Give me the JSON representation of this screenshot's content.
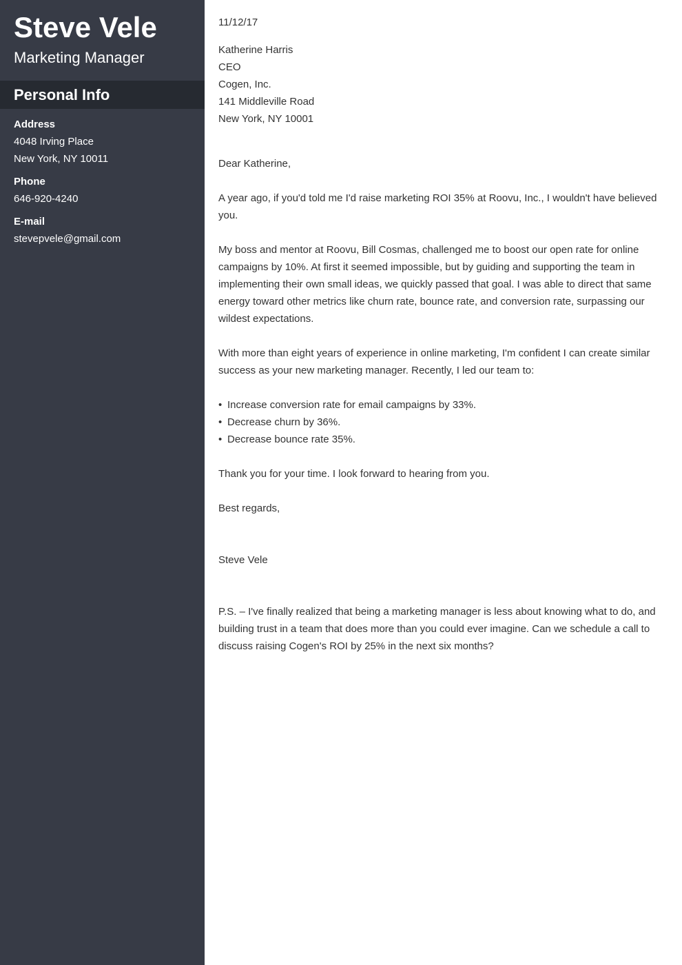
{
  "sidebar": {
    "name": "Steve Vele",
    "job_title": "Marketing Manager",
    "section_title": "Personal Info",
    "address": {
      "label": "Address",
      "lines": [
        "4048 Irving Place",
        "New York, NY 10011"
      ]
    },
    "phone": {
      "label": "Phone",
      "value": "646-920-4240"
    },
    "email": {
      "label": "E-mail",
      "value": "stevepvele@gmail.com"
    }
  },
  "letter": {
    "date": "11/12/17",
    "recipient": {
      "name": "Katherine Harris",
      "title": "CEO",
      "company": "Cogen, Inc.",
      "street": "141 Middleville Road",
      "city": "New York, NY 10001"
    },
    "salutation": "Dear Katherine,",
    "paragraphs": [
      "A year ago, if you'd told me I'd raise marketing ROI 35% at Roovu, Inc., I wouldn't have believed you.",
      "My boss and mentor at Roovu, Bill Cosmas, challenged me to boost our open rate for online campaigns by 10%. At first it seemed impossible, but by guiding and supporting the team in implementing their own small ideas, we quickly passed that goal. I was able to direct that same energy toward other metrics like churn rate, bounce rate, and conversion rate, surpassing our wildest expectations.",
      "With more than eight years of experience in online marketing, I'm confident I can create similar success as your new marketing manager. Recently, I led our team to:"
    ],
    "bullet_glyph": "•",
    "bullets": [
      "Increase conversion rate for email campaigns by 33%.",
      "Decrease churn by 36%.",
      "Decrease bounce rate 35%."
    ],
    "thanks": "Thank you for your time. I look forward to hearing from you.",
    "closing": "Best regards,",
    "signature": "Steve Vele",
    "postscript": "P.S. – I've finally realized that being a marketing manager is less about knowing what to do, and building trust in a team that does more than you could ever imagine. Can we schedule a call to discuss raising Cogen's ROI by 25% in the next six months?"
  }
}
